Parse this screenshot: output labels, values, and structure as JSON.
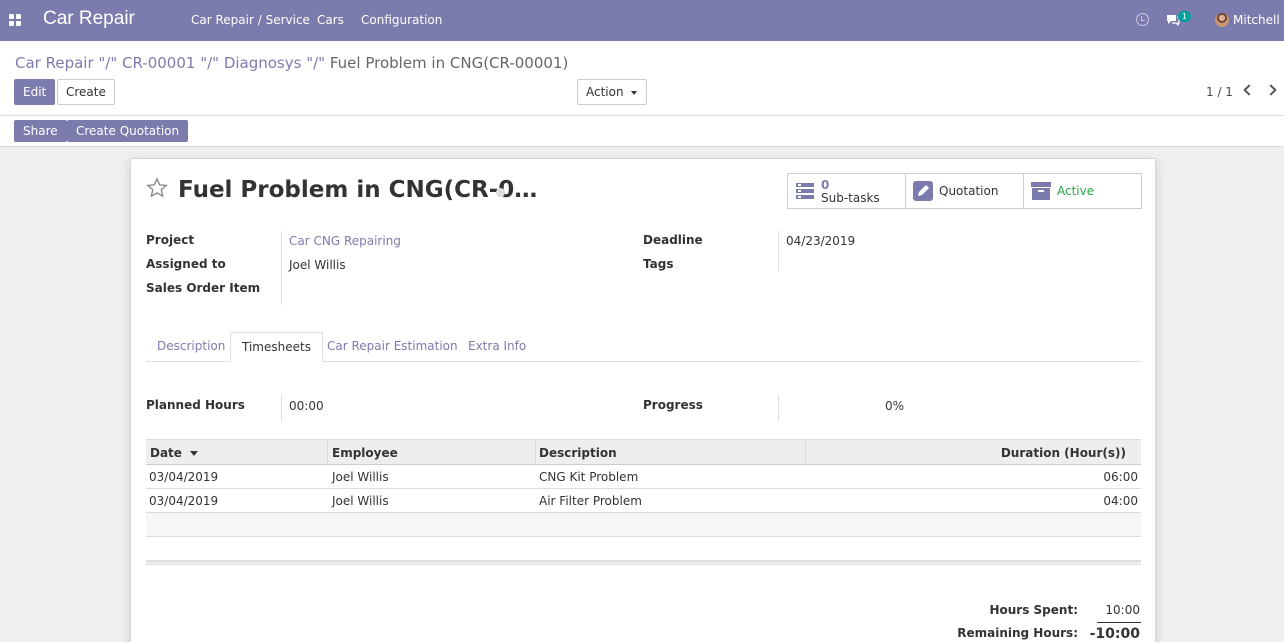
{
  "navbar": {
    "brand": "Car Repair",
    "menu": [
      "Car Repair / Service",
      "Cars",
      "Configuration"
    ],
    "chat_badge": "1",
    "user": "Mitchell"
  },
  "breadcrumb": {
    "items": [
      "Car Repair \"/\" CR-00001 \"/\" Diagnosys \"/\""
    ],
    "current": "Fuel Problem in CNG(CR-00001)"
  },
  "toolbar": {
    "edit_label": "Edit",
    "create_label": "Create",
    "action_label": "Action",
    "pager": "1 / 1"
  },
  "status_bar": {
    "share_label": "Share",
    "quotation_label": "Create Quotation"
  },
  "form": {
    "title": "Fuel Problem in CNG(CR-0…",
    "smart_buttons": {
      "subtasks_count": "0",
      "subtasks_label": "Sub-tasks",
      "quotation_label": "Quotation",
      "active_label": "Active"
    },
    "fields": {
      "project_label": "Project",
      "project_value": "Car CNG Repairing",
      "assigned_label": "Assigned to",
      "assigned_value": "Joel Willis",
      "sales_label": "Sales Order Item",
      "deadline_label": "Deadline",
      "deadline_value": "04/23/2019",
      "tags_label": "Tags"
    },
    "tabs": [
      "Description",
      "Timesheets",
      "Car Repair Estimation",
      "Extra Info"
    ],
    "active_tab": "Timesheets",
    "planned_label": "Planned Hours",
    "planned_value": "00:00",
    "progress_label": "Progress",
    "progress_value": "0%",
    "table": {
      "headers": [
        "Date",
        "Employee",
        "Description",
        "Duration (Hour(s))"
      ],
      "rows": [
        [
          "03/04/2019",
          "Joel Willis",
          "CNG Kit Problem",
          "06:00"
        ],
        [
          "03/04/2019",
          "Joel Willis",
          "Air Filter Problem",
          "04:00"
        ]
      ]
    },
    "hours_spent_label": "Hours Spent:",
    "hours_spent_value": "10:00",
    "remaining_label": "Remaining Hours:",
    "remaining_value": "-10:00"
  },
  "colors": {
    "brand": "#7c7bad",
    "active_green": "#28a745"
  }
}
